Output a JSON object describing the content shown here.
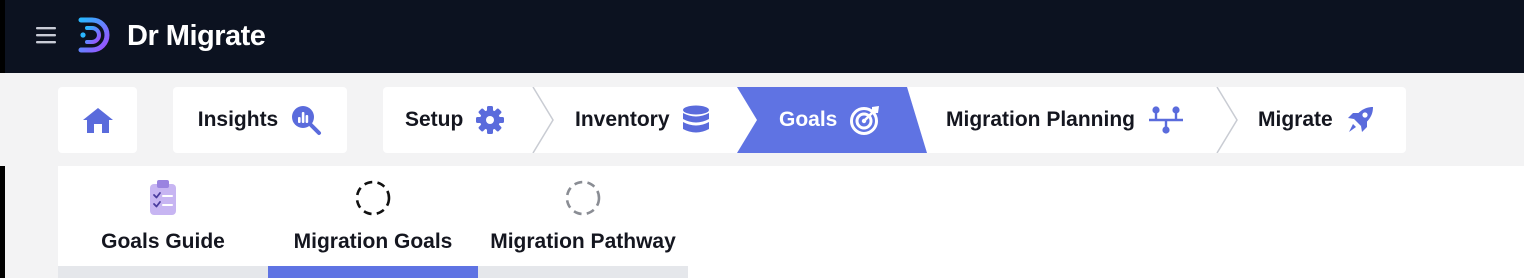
{
  "app": {
    "title": "Dr Migrate"
  },
  "header": {
    "menu_icon": "hamburger-icon",
    "logo_icon": "dr-migrate-logo-icon"
  },
  "nav": {
    "home": {
      "icon": "home-icon"
    },
    "insights": {
      "label": "Insights",
      "icon": "chart-magnifier-icon"
    },
    "steps": [
      {
        "label": "Setup",
        "icon": "gear-icon",
        "active": false
      },
      {
        "label": "Inventory",
        "icon": "database-icon",
        "active": false
      },
      {
        "label": "Goals",
        "icon": "target-icon",
        "active": true
      },
      {
        "label": "Migration Planning",
        "icon": "flow-nodes-icon",
        "active": false
      },
      {
        "label": "Migrate",
        "icon": "rocket-icon",
        "active": false
      }
    ]
  },
  "tabs": [
    {
      "label": "Goals Guide",
      "icon": "clipboard-checklist-icon",
      "active": false
    },
    {
      "label": "Migration Goals",
      "icon": "dashed-circle-icon",
      "active": true
    },
    {
      "label": "Migration Pathway",
      "icon": "dashed-circle-icon",
      "active": false
    }
  ],
  "colors": {
    "topbar": "#0c1220",
    "accent": "#5f73e3",
    "icon_purple": "#5a6bdc",
    "tab_inactive_bar": "#e5e7eb",
    "page_bg": "#f3f3f4"
  }
}
